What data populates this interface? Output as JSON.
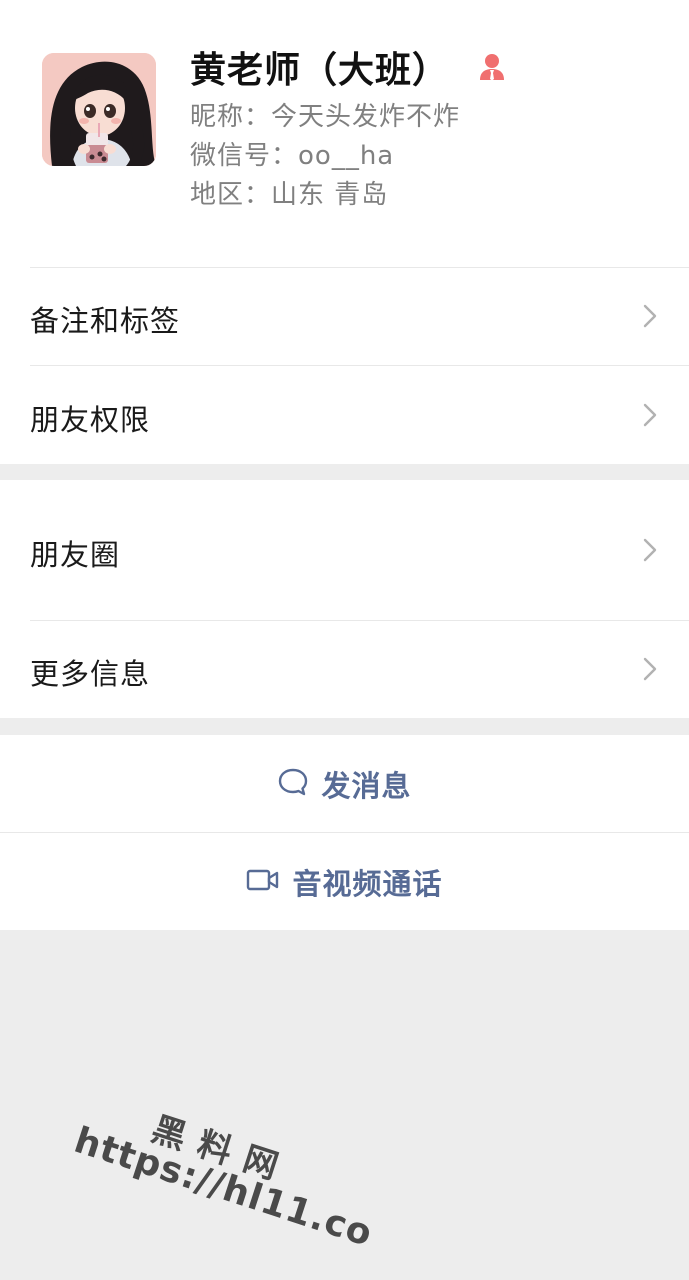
{
  "profile": {
    "display_name": "黄老师（大班）",
    "nickname_label": "昵称：",
    "nickname": "今天头发炸不炸",
    "wechat_id_label": "微信号：",
    "wechat_id": "oo__ha",
    "region_label": "地区：",
    "region": "山东 青岛",
    "role_icon": "person-with-tie-icon",
    "role_icon_color": "#f06f6f"
  },
  "menu": {
    "remark_tags": "备注和标签",
    "friend_permissions": "朋友权限",
    "moments": "朋友圈",
    "more_info": "更多信息"
  },
  "actions": {
    "send_message": "发消息",
    "av_call": "音视频通话",
    "accent_color": "#576b95"
  },
  "watermark": {
    "line1": "黑料网",
    "line2": "https://hl11.co"
  }
}
